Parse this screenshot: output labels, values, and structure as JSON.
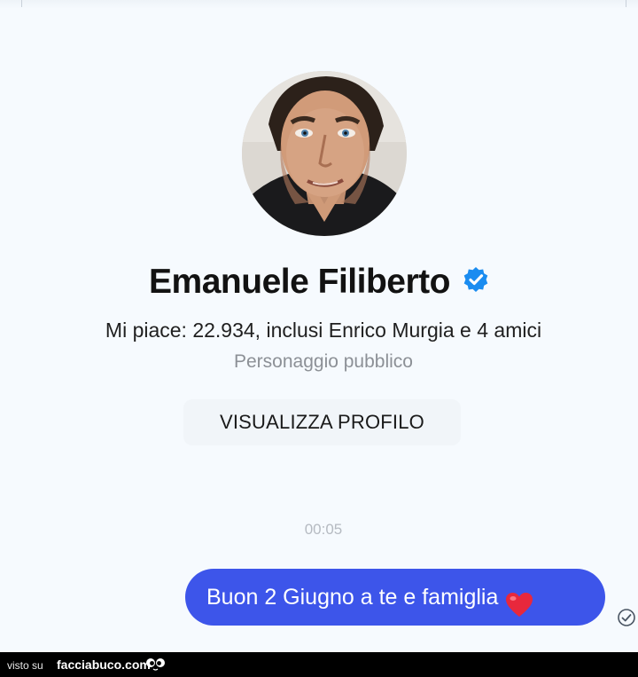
{
  "profile": {
    "name": "Emanuele Filiberto",
    "verified": true,
    "likes_text": "Mi piace: 22.934, inclusi Enrico Murgia e 4 amici",
    "category": "Personaggio pubblico",
    "view_profile_label": "VISUALIZZA PROFILO"
  },
  "conversation": {
    "timestamp": "00:05",
    "message": {
      "text": "Buon 2 Giugno a te e famiglia",
      "emoji": "red-heart"
    }
  },
  "watermark": {
    "prefix": "visto su",
    "site": "facciabuco.com"
  },
  "colors": {
    "bubble": "#3d55ea",
    "verified": "#1a8cf0",
    "heart": "#e8283c",
    "background": "#f6fafe"
  },
  "icons": {
    "verified": "verified-badge-icon",
    "read_receipt": "read-receipt-icon",
    "heart": "heart-emoji-icon",
    "watermark_logo": "facciabuco-eyes-icon"
  }
}
